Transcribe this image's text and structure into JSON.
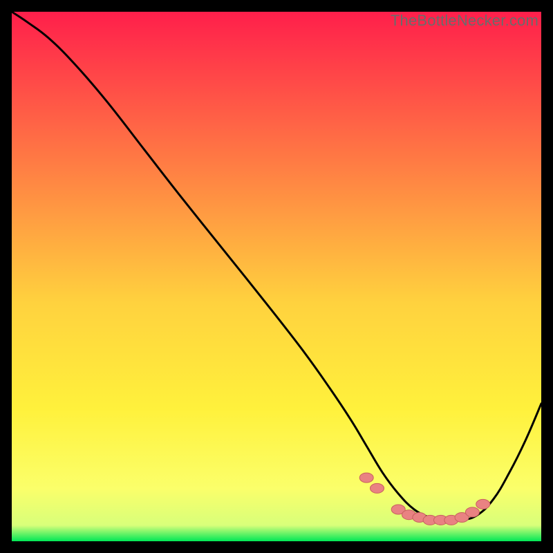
{
  "watermark": "TheBottleNecker.com",
  "colors": {
    "grad_top": "#ff1f4b",
    "grad_mid1": "#ff7a44",
    "grad_mid2": "#ffd23e",
    "grad_mid3": "#fff13c",
    "grad_mid4": "#fbff6a",
    "grad_bottom": "#00e756",
    "curve": "#000000",
    "dot_fill": "#e98282",
    "dot_stroke": "#c85f5f"
  },
  "chart_data": {
    "type": "line",
    "title": "",
    "xlabel": "",
    "ylabel": "",
    "xlim": [
      0,
      100
    ],
    "ylim": [
      0,
      100
    ],
    "series": [
      {
        "name": "curve",
        "x": [
          0,
          3,
          7,
          12,
          18,
          25,
          32,
          40,
          48,
          55,
          60,
          64,
          67,
          70,
          73,
          76,
          79,
          82,
          85,
          88,
          91,
          94,
          97,
          100
        ],
        "y": [
          100,
          98,
          95,
          90,
          83,
          74,
          65,
          55,
          45,
          36,
          29,
          23,
          18,
          13,
          9,
          6,
          4.5,
          4,
          4,
          5,
          8,
          13,
          19,
          26
        ]
      }
    ],
    "scatter_points": {
      "name": "dots",
      "x": [
        67,
        69,
        73,
        75,
        77,
        79,
        81,
        83,
        85,
        87,
        89
      ],
      "y": [
        12,
        10,
        6,
        5,
        4.5,
        4,
        4,
        4,
        4.5,
        5.5,
        7
      ]
    }
  }
}
